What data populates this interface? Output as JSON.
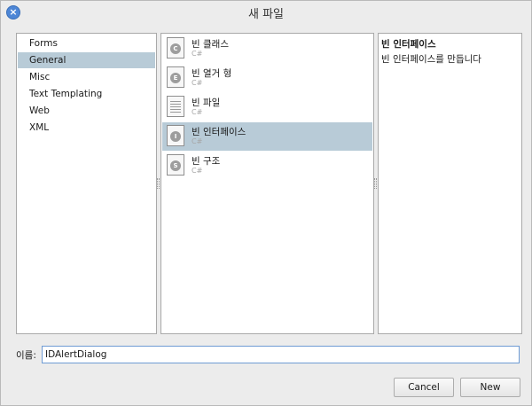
{
  "window": {
    "title": "새 파일",
    "close_glyph": "×"
  },
  "categories": [
    {
      "label": "Forms",
      "selected": false
    },
    {
      "label": "General",
      "selected": true
    },
    {
      "label": "Misc",
      "selected": false
    },
    {
      "label": "Text Templating",
      "selected": false
    },
    {
      "label": "Web",
      "selected": false
    },
    {
      "label": "XML",
      "selected": false
    }
  ],
  "templates": [
    {
      "name": "빈 클래스",
      "lang": "C#",
      "icon": "class-icon",
      "badge": "C",
      "selected": false
    },
    {
      "name": "빈 열거 형",
      "lang": "C#",
      "icon": "enum-icon",
      "badge": "E",
      "selected": false
    },
    {
      "name": "빈 파일",
      "lang": "C#",
      "icon": "file-icon",
      "badge": "",
      "selected": false
    },
    {
      "name": "빈 인터페이스",
      "lang": "C#",
      "icon": "interface-icon",
      "badge": "I",
      "selected": true
    },
    {
      "name": "빈 구조",
      "lang": "C#",
      "icon": "struct-icon",
      "badge": "S",
      "selected": false
    }
  ],
  "description": {
    "title": "빈 인터페이스",
    "text": "빈 인터페이스를 만듭니다"
  },
  "name_field": {
    "label": "이름:",
    "value": "IDAlertDialog"
  },
  "buttons": {
    "cancel": "Cancel",
    "new": "New"
  },
  "colors": {
    "selection": "#b8cbd7",
    "close_button": "#4d86d6",
    "focus_border": "#6e9bd4"
  }
}
